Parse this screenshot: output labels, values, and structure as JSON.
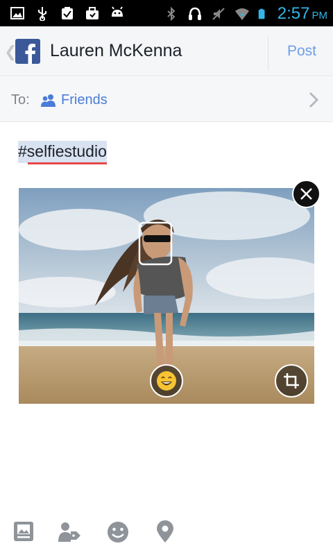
{
  "status_bar": {
    "time": "2:57",
    "ampm": "PM",
    "icons": [
      "gallery-icon",
      "usb-icon",
      "clipboard-check-icon",
      "briefcase-icon",
      "android-icon",
      "bluetooth-icon",
      "headset-icon",
      "mute-icon",
      "wifi-icon",
      "battery-icon"
    ]
  },
  "header": {
    "app_icon": "facebook-icon",
    "title": "Lauren McKenna",
    "post_label": "Post"
  },
  "audience": {
    "to_label": "To:",
    "audience_label": "Friends"
  },
  "compose": {
    "text": "#selfiestudio"
  },
  "photo": {
    "description_icons": [
      "close-icon",
      "emoji-icon",
      "crop-icon"
    ]
  },
  "bottom_bar": {
    "icons": [
      "photo-album-icon",
      "tag-people-icon",
      "feeling-icon",
      "location-icon"
    ]
  },
  "colors": {
    "status_clock": "#33b5e5",
    "post_link": "#6d9ee6",
    "friends_link": "#4a7cd8",
    "facebook_blue": "#3b5998",
    "spell_underline": "#e54848",
    "bottom_icons": "#8f939a"
  }
}
